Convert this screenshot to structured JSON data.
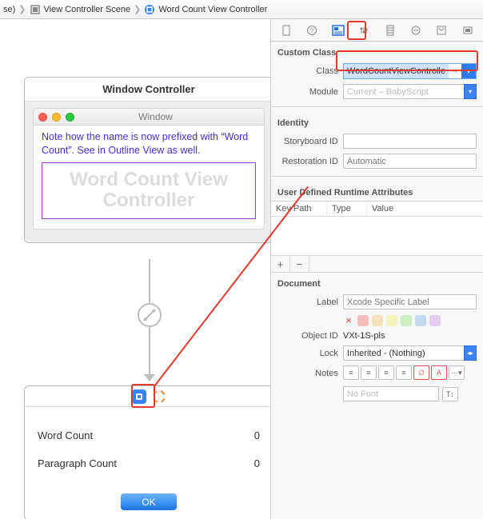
{
  "breadcrumb": {
    "partial": "se)",
    "item1": "View Controller Scene",
    "item2": "Word Count View Controller"
  },
  "canvas": {
    "window_controller_title": "Window Controller",
    "window_title": "Window",
    "note_text": "Note how the name is now prefixed with “Word Count”. See in Outline View as well.",
    "ghost_label": "Word Count View Controller",
    "rows": [
      {
        "label": "Word Count",
        "value": "0"
      },
      {
        "label": "Paragraph Count",
        "value": "0"
      }
    ],
    "ok_label": "OK"
  },
  "inspector": {
    "custom_class_section": "Custom Class",
    "class_label": "Class",
    "class_value": "WordCountViewControlle",
    "module_label": "Module",
    "module_placeholder": "Current – BabyScript",
    "identity_section": "Identity",
    "storyboard_id_label": "Storyboard ID",
    "storyboard_id_value": "",
    "restoration_id_label": "Restoration ID",
    "restoration_id_placeholder": "Automatic",
    "udra_section": "User Defined Runtime Attributes",
    "udra_cols": {
      "c1": "Key Path",
      "c2": "Type",
      "c3": "Value"
    },
    "document_section": "Document",
    "label_label": "Label",
    "label_placeholder": "Xcode Specific Label",
    "swatch_x": "×",
    "object_id_label": "Object ID",
    "object_id_value": "VXt-1S-pls",
    "lock_label": "Lock",
    "lock_value": "Inherited - (Nothing)",
    "notes_label": "Notes",
    "no_font": "No Font"
  },
  "colors": {
    "swatches": [
      "#f6bdbd",
      "#f6e1bd",
      "#f6f4bd",
      "#cdeec3",
      "#c3d9f2",
      "#e2cdf2"
    ]
  }
}
